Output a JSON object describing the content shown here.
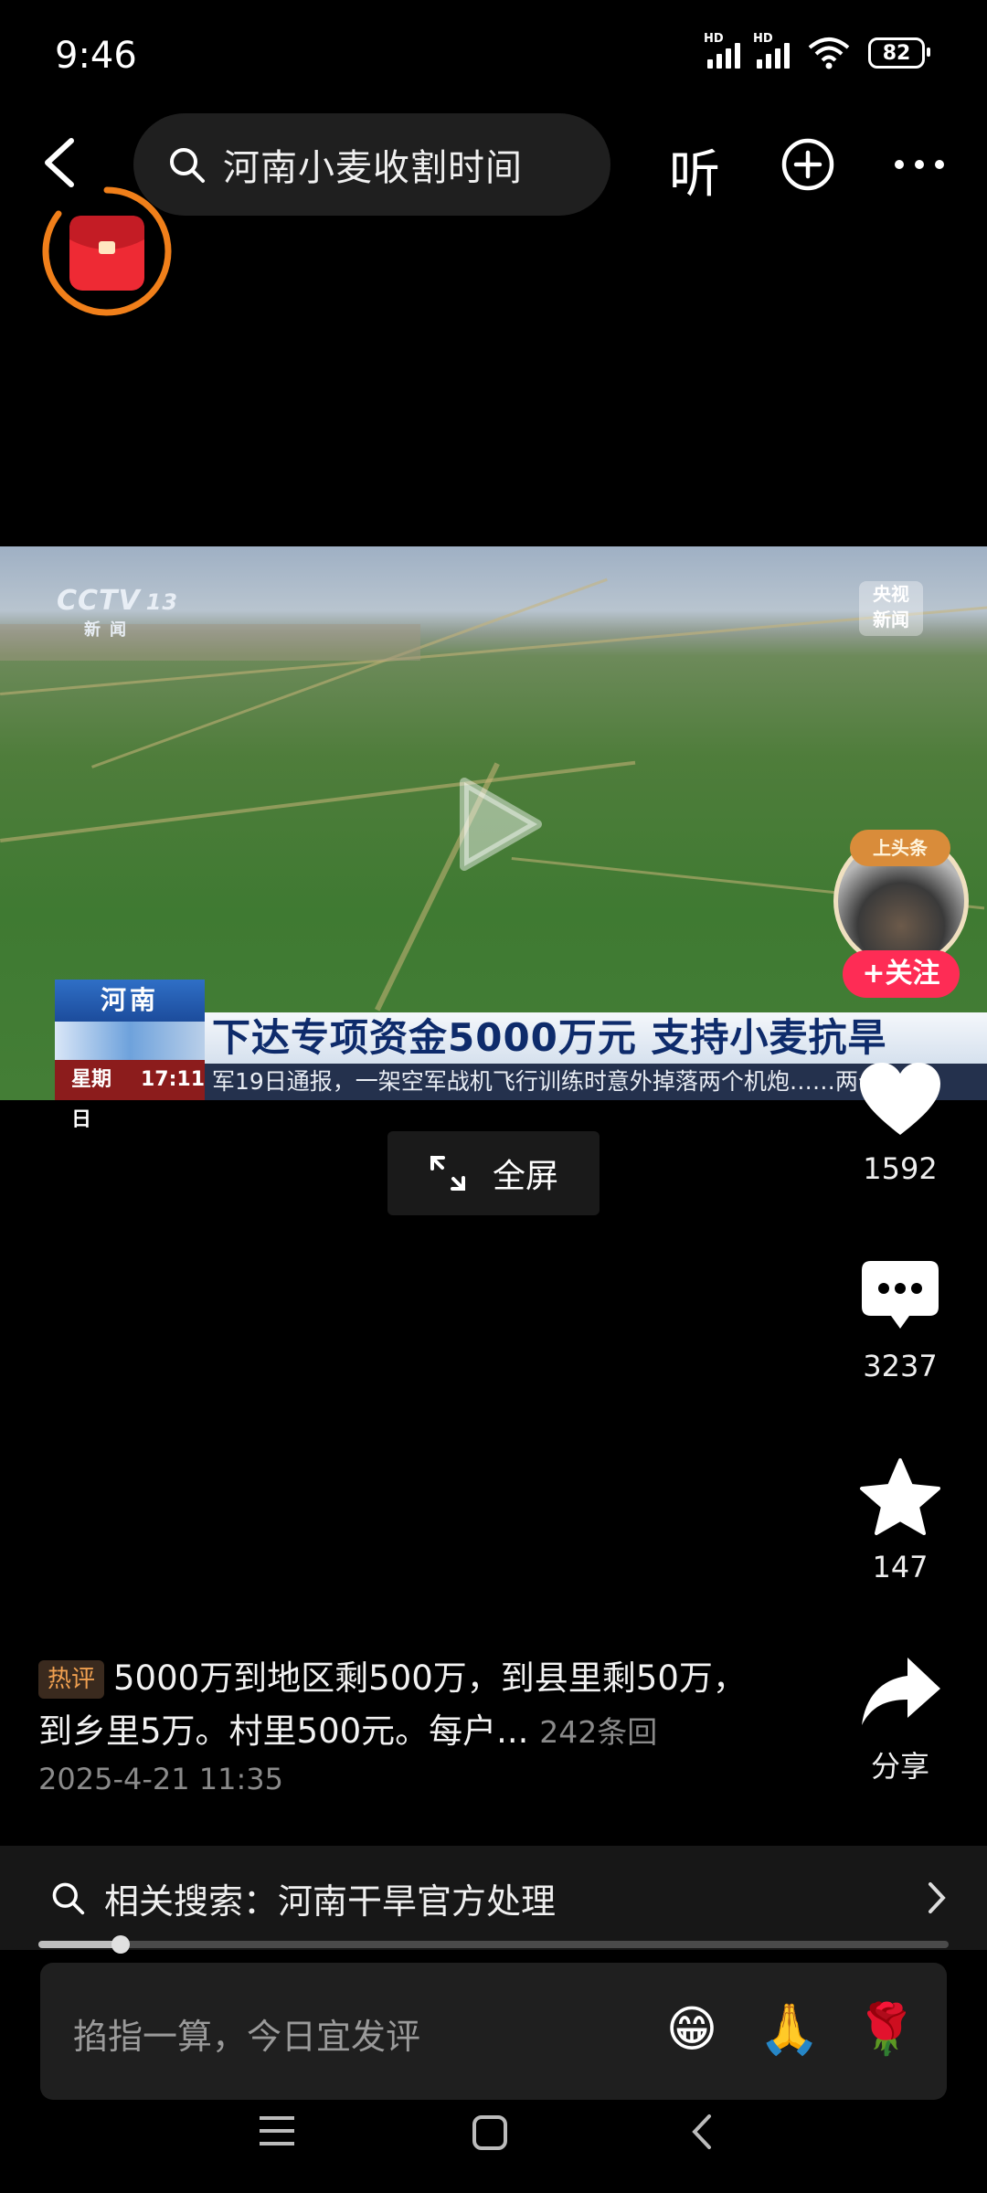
{
  "status_bar": {
    "time": "9:46",
    "network_1": "HD",
    "network_2": "HD",
    "wifi_label": "6",
    "battery": "82"
  },
  "search": {
    "query": "河南小麦收割时间"
  },
  "top_actions": {
    "listen_label": "听"
  },
  "video": {
    "channel_logo": "CCTV",
    "channel_number": "13",
    "channel_sub": "新闻",
    "corner_logo_line1": "央视",
    "corner_logo_line2": "新闻",
    "region_label": "河南",
    "headline": "下达专项资金5000万元 支持小麦抗旱",
    "date_label": "星期日",
    "time_label": "17:11",
    "ticker": "军19日通报，一架空军战机飞行训练时意外掉落两个机炮……两个"
  },
  "creator": {
    "badge": "上头条",
    "follow_label": "+关注"
  },
  "fullscreen_label": "全屏",
  "actions": {
    "likes": "1592",
    "comments": "3237",
    "favorites": "147",
    "share_label": "分享"
  },
  "hot_comment": {
    "badge": "热评",
    "text": "5000万到地区剩500万，到县里剩50万，到乡里5万。村里500元。每户...",
    "replies": "242条回",
    "date": "2025-4-21 11:35"
  },
  "related_search": {
    "label": "相关搜索：河南干旱官方处理"
  },
  "progress": {
    "fraction": 0.09
  },
  "comment_box": {
    "placeholder": "掐指一算，今日宜发评"
  },
  "emojis": [
    "😁",
    "🙏",
    "🌹"
  ]
}
